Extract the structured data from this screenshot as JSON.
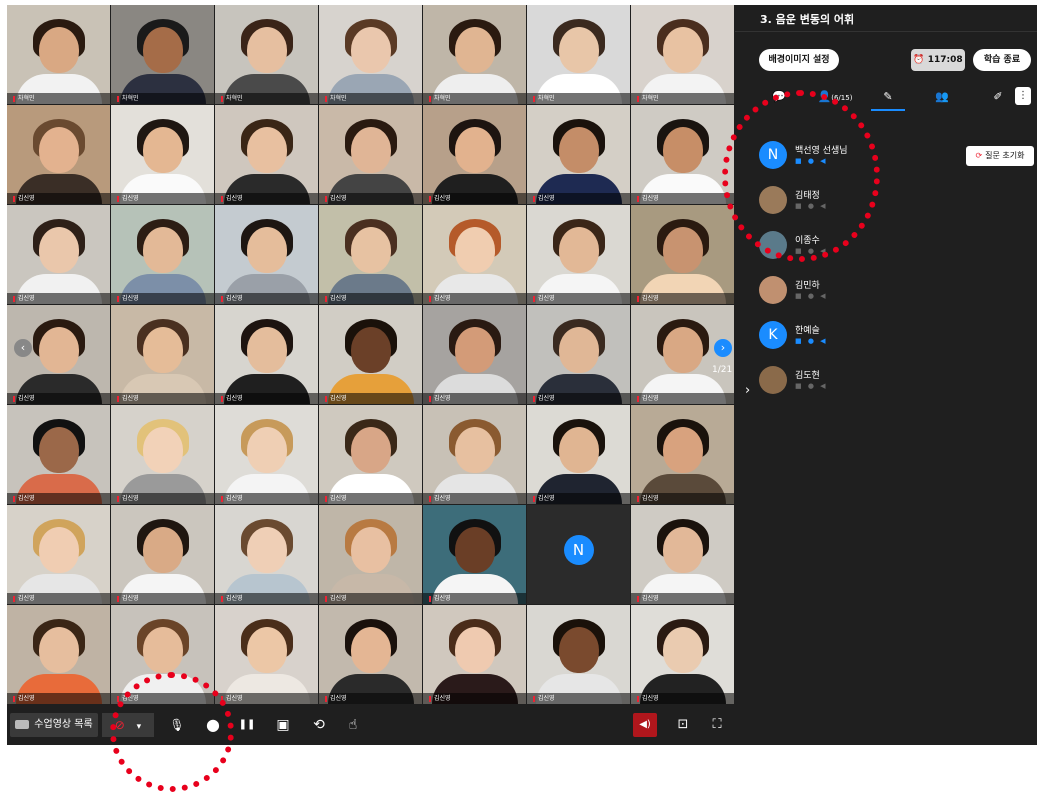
{
  "grid": {
    "tiles": [
      {
        "label": "차혁민",
        "skin": "#d9a883",
        "hair": "#2a1a10",
        "body": "#f2f2f2",
        "bg": "#c9c2b6"
      },
      {
        "label": "차혁민",
        "skin": "#a56c48",
        "hair": "#1a1a1a",
        "body": "#2c3040",
        "bg": "#8a8782"
      },
      {
        "label": "차혁민",
        "skin": "#e6bfa0",
        "hair": "#3a2418",
        "body": "#4a4a4a",
        "bg": "#c7c4bd"
      },
      {
        "label": "차혁민",
        "skin": "#eac7ad",
        "hair": "#5a3a25",
        "body": "#9aa6b4",
        "bg": "#d7d3ce"
      },
      {
        "label": "차혁민",
        "skin": "#e0b592",
        "hair": "#2a1a10",
        "body": "#eeeeee",
        "bg": "#bfb6a8"
      },
      {
        "label": "차혁민",
        "skin": "#e8c6a8",
        "hair": "#3b2a1f",
        "body": "#ffffff",
        "bg": "#d9d9d9"
      },
      {
        "label": "차혁민",
        "skin": "#e8c2a2",
        "hair": "#4a2e1e",
        "body": "#f3f3f3",
        "bg": "#d8d2cc"
      },
      {
        "label": "김신영",
        "skin": "#e3b28f",
        "hair": "#6a4a30",
        "body": "#3a2e26",
        "bg": "#b89a7c"
      },
      {
        "label": "김신영",
        "skin": "#e4b792",
        "hair": "#1f1712",
        "body": "#fafafa",
        "bg": "#e3e0da"
      },
      {
        "label": "김신영",
        "skin": "#e8c0a0",
        "hair": "#3a2616",
        "body": "#2a2a2a",
        "bg": "#cfc7be"
      },
      {
        "label": "김신영",
        "skin": "#e0b596",
        "hair": "#2a1a10",
        "body": "#444444",
        "bg": "#c9b9a8"
      },
      {
        "label": "김신영",
        "skin": "#e2b28e",
        "hair": "#1d1410",
        "body": "#1f1f1f",
        "bg": "#b7a08a"
      },
      {
        "label": "김신영",
        "skin": "#c48d68",
        "hair": "#1a120c",
        "body": "#1e2a52",
        "bg": "#d4cfc6"
      },
      {
        "label": "김신영",
        "skin": "#c78e67",
        "hair": "#1a1410",
        "body": "#fafafa",
        "bg": "#cfcbc4"
      },
      {
        "label": "김신영",
        "skin": "#eac7ab",
        "hair": "#2e2018",
        "body": "#f1f1f1",
        "bg": "#cac6bf"
      },
      {
        "label": "김신영",
        "skin": "#e3b997",
        "hair": "#2c1d14",
        "body": "#7c8fa8",
        "bg": "#b6c2b8"
      },
      {
        "label": "김신영",
        "skin": "#e5bd9b",
        "hair": "#1d1612",
        "body": "#9aa0a8",
        "bg": "#c4cbd0"
      },
      {
        "label": "김신영",
        "skin": "#e7c2a2",
        "hair": "#4a2f20",
        "body": "#6b7a8a",
        "bg": "#c2bfa9"
      },
      {
        "label": "김신영",
        "skin": "#f0cdb0",
        "hair": "#b55a2a",
        "body": "#e8e8e8",
        "bg": "#d3cab8"
      },
      {
        "label": "김신영",
        "skin": "#e2b896",
        "hair": "#3a2618",
        "body": "#f5f5f5",
        "bg": "#dad8d2"
      },
      {
        "label": "김신영",
        "skin": "#c89370",
        "hair": "#2a1a10",
        "body": "#f2d5b5",
        "bg": "#a89a80"
      },
      {
        "label": "김신영",
        "skin": "#e2b694",
        "hair": "#2a1a10",
        "body": "#2a2a2a",
        "bg": "#bdb7ae"
      },
      {
        "label": "김신영",
        "skin": "#e5bc98",
        "hair": "#4a3020",
        "body": "#d8c8b4",
        "bg": "#c8b9a6"
      },
      {
        "label": "김신영",
        "skin": "#e4bd9c",
        "hair": "#1d1410",
        "body": "#1f1f1f",
        "bg": "#d7d5cf"
      },
      {
        "label": "김신영",
        "skin": "#6b4028",
        "hair": "#1a110a",
        "body": "#e6a03a",
        "bg": "#d1cdc5"
      },
      {
        "label": "김신영",
        "skin": "#d39b78",
        "hair": "#2a1a12",
        "body": "#dcdcdc",
        "bg": "#a6a3a0"
      },
      {
        "label": "김신영",
        "skin": "#e0b796",
        "hair": "#3a2a20",
        "body": "#2a2f3a",
        "bg": "#c1c0bc"
      },
      {
        "label": "김신영",
        "skin": "#d9a884",
        "hair": "#2a1a10",
        "body": "#f5f5f5",
        "bg": "#c9c5bd"
      },
      {
        "label": "김신영",
        "skin": "#9b6849",
        "hair": "#111111",
        "body": "#d96b4a",
        "bg": "#c7c3bc"
      },
      {
        "label": "김신영",
        "skin": "#f2d2b8",
        "hair": "#e2c27a",
        "body": "#9a9a9a",
        "bg": "#d6d2cb"
      },
      {
        "label": "김신영",
        "skin": "#efcfb4",
        "hair": "#c79a5a",
        "body": "#f4f4f4",
        "bg": "#dedcd7"
      },
      {
        "label": "김신영",
        "skin": "#d8a687",
        "hair": "#3a2818",
        "body": "#ffffff",
        "bg": "#cfc9bf"
      },
      {
        "label": "김신영",
        "skin": "#e7c0a0",
        "hair": "#8a5a30",
        "body": "#e5e5e5",
        "bg": "#c8c1b6"
      },
      {
        "label": "김신영",
        "skin": "#e0b592",
        "hair": "#1a120c",
        "body": "#1f2430",
        "bg": "#dcdad4"
      },
      {
        "label": "김신영",
        "skin": "#d8a27e",
        "hair": "#1a120c",
        "body": "#5a4a3a",
        "bg": "#b8aa96"
      },
      {
        "label": "김신영",
        "skin": "#f0cdb2",
        "hair": "#d0a45c",
        "body": "#e6e6e6",
        "bg": "#d7d2c9"
      },
      {
        "label": "김신영",
        "skin": "#d9aa86",
        "hair": "#1f1610",
        "body": "#f5f5f5",
        "bg": "#cbc6be"
      },
      {
        "label": "김신영",
        "skin": "#efcfb6",
        "hair": "#6a4a30",
        "body": "#b7c5cf",
        "bg": "#d8d6d1"
      },
      {
        "label": "김신영",
        "skin": "#e8c0a2",
        "hair": "#b87a42",
        "body": "#c7b8a8",
        "bg": "#bfb6a8"
      },
      {
        "label": "김신영",
        "skin": "#6a3e26",
        "hair": "#111111",
        "body": "#f5f5f5",
        "bg": "#3d6d7a"
      },
      {
        "label": "",
        "empty": true
      },
      {
        "label": "김신영",
        "skin": "#e2b898",
        "hair": "#1a120c",
        "body": "#f5f5f5",
        "bg": "#cfcbc4"
      },
      {
        "label": "김신영",
        "skin": "#e6be9e",
        "hair": "#3a2616",
        "body": "#e86b3a",
        "bg": "#bfb3a4"
      },
      {
        "label": "김신영",
        "skin": "#e6bc9a",
        "hair": "#6a4428",
        "body": "#f0f0f0",
        "bg": "#c7c2bb"
      },
      {
        "label": "김신영",
        "skin": "#ecc7a6",
        "hair": "#4a2e1a",
        "body": "#ede8e2",
        "bg": "#d8d2cc"
      },
      {
        "label": "김신영",
        "skin": "#e4b694",
        "hair": "#1a110c",
        "body": "#2a2a2a",
        "bg": "#c2b9ad"
      },
      {
        "label": "김신영",
        "skin": "#efcab0",
        "hair": "#4a2c1a",
        "body": "#2a1a1a",
        "bg": "#d0c8be"
      },
      {
        "label": "김신영",
        "skin": "#7a4a2e",
        "hair": "#1a110a",
        "body": "#e6e6e6",
        "bg": "#d9d7d2"
      },
      {
        "label": "김신영",
        "skin": "#eacbb0",
        "hair": "#2a1a12",
        "body": "#222222",
        "bg": "#dfddd8"
      }
    ],
    "empty_avatar_letter": "N",
    "page_indicator": "1/21",
    "prev_arrow": "‹",
    "next_arrow": "›"
  },
  "toolbar": {
    "class_video_list_label": "수업영상 목록",
    "camera_dropdown_caret": "▾",
    "mic_icon": "🎤",
    "record_icon": "●",
    "pause_icon": "❚❚",
    "pip_icon": "▣",
    "loop_icon": "⟲",
    "hand_icon": "☝",
    "speaker_icon": "🔊",
    "screen_icon": "⛶",
    "fullscreen_icon": "⛶"
  },
  "panel": {
    "lesson_title": "3. 음운 변동의 어휘",
    "bg_setting_label": "배경이미지 설정",
    "timer_value": "117:08",
    "end_study_label": "학습 종료",
    "tab_people_count": "(6/15)",
    "reset_question_label": "질문 초기화",
    "participants": [
      {
        "name": "백선영 선생님",
        "letter": "N",
        "icons_on": true
      },
      {
        "name": "김태정",
        "photo": "#9a7a5a",
        "icons_on": false
      },
      {
        "name": "이종수",
        "photo": "#5a7a8a",
        "icons_on": false
      },
      {
        "name": "김민하",
        "photo": "#c09070",
        "icons_on": false
      },
      {
        "name": "한예슬",
        "letter": "K",
        "icons_on": true
      },
      {
        "name": "김도현",
        "photo": "#8a6a4a",
        "icons_on": false
      }
    ]
  },
  "colors": {
    "accent": "#1a8cff",
    "annotation": "#e8001c",
    "panel_bg": "#1f1f1f"
  }
}
